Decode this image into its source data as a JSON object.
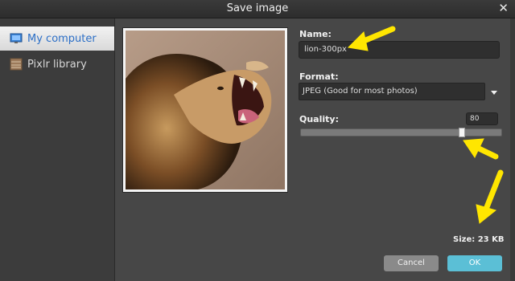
{
  "dialog": {
    "title": "Save image",
    "close_icon": "close-icon"
  },
  "sidebar": {
    "items": [
      {
        "label": "My computer",
        "icon": "monitor-icon",
        "active": true
      },
      {
        "label": "Pixlr library",
        "icon": "library-icon",
        "active": false
      }
    ]
  },
  "form": {
    "name_label": "Name:",
    "name_value": "lion-300px",
    "format_label": "Format:",
    "format_value": "JPEG (Good for most photos)",
    "quality_label": "Quality:",
    "quality_value": "80",
    "quality_fraction": 0.8,
    "size_text": "Size: 23 KB"
  },
  "buttons": {
    "cancel": "Cancel",
    "ok": "OK"
  },
  "colors": {
    "accent": "#5bbfd6",
    "annotation": "#ffe600",
    "active_text": "#2c6fc7"
  },
  "preview": {
    "subject": "roaring lion photo"
  }
}
